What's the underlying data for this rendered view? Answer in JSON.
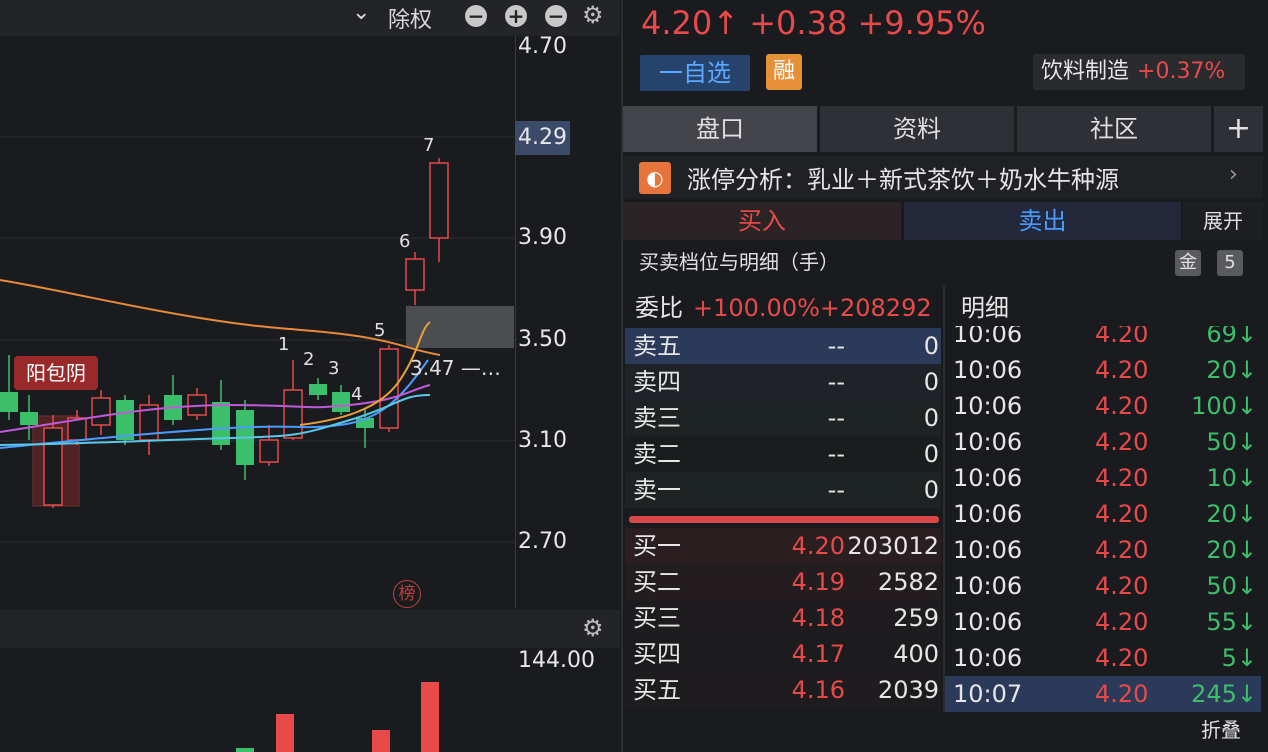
{
  "toolbar": {
    "dropdown_icon": "chevron-down",
    "chuquan_label": "除权"
  },
  "axis": {
    "ticks": [
      "4.70",
      "3.90",
      "3.50",
      "3.10",
      "2.70"
    ],
    "current": "4.29",
    "vol_tick": "144.00"
  },
  "chart": {
    "pattern_label": "阳包阴",
    "candle_numbers": [
      "1",
      "2",
      "3",
      "4",
      "5",
      "6",
      "7"
    ],
    "ma_label": "3.47 —…",
    "bang_label": "榜",
    "colors": {
      "up": "#e84a4a",
      "down": "#3bbf6a",
      "ma_orange": "#e88a3a",
      "ma_blue": "#4a9bff",
      "ma_purple": "#c05ad8",
      "ma_cyan": "#5ac8e8"
    }
  },
  "quote": {
    "price": "4.20↑",
    "change": "+0.38",
    "change_pct": "+9.95%",
    "watch_label": "一自选",
    "margin_label": "融",
    "industry": "饮料制造",
    "industry_chg": "+0.37%"
  },
  "tabs": [
    "盘口",
    "资料",
    "社区",
    "+"
  ],
  "limit_up": {
    "text": "涨停分析：乳业＋新式茶饮＋奶水牛种源",
    "arrow": "›"
  },
  "trade": {
    "buy": "买入",
    "sell": "卖出",
    "expand": "展开"
  },
  "book": {
    "title": "买卖档位与明细（手）",
    "badge_gold": "金",
    "badge_level": "5",
    "weibi_label": "委比",
    "weibi_value": "+100.00%+208292",
    "mingxi_label": "明细",
    "asks": [
      {
        "label": "卖五",
        "price": "--",
        "qty": "0"
      },
      {
        "label": "卖四",
        "price": "--",
        "qty": "0"
      },
      {
        "label": "卖三",
        "price": "--",
        "qty": "0"
      },
      {
        "label": "卖二",
        "price": "--",
        "qty": "0"
      },
      {
        "label": "卖一",
        "price": "--",
        "qty": "0"
      }
    ],
    "bids": [
      {
        "label": "买一",
        "price": "4.20",
        "qty": "203012"
      },
      {
        "label": "买二",
        "price": "4.19",
        "qty": "2582"
      },
      {
        "label": "买三",
        "price": "4.18",
        "qty": "259"
      },
      {
        "label": "买四",
        "price": "4.17",
        "qty": "400"
      },
      {
        "label": "买五",
        "price": "4.16",
        "qty": "2039"
      }
    ]
  },
  "trades": [
    {
      "time": "10:06",
      "price": "4.20",
      "qty": "69↓"
    },
    {
      "time": "10:06",
      "price": "4.20",
      "qty": "20↓"
    },
    {
      "time": "10:06",
      "price": "4.20",
      "qty": "100↓"
    },
    {
      "time": "10:06",
      "price": "4.20",
      "qty": "50↓"
    },
    {
      "time": "10:06",
      "price": "4.20",
      "qty": "10↓"
    },
    {
      "time": "10:06",
      "price": "4.20",
      "qty": "20↓"
    },
    {
      "time": "10:06",
      "price": "4.20",
      "qty": "20↓"
    },
    {
      "time": "10:06",
      "price": "4.20",
      "qty": "50↓"
    },
    {
      "time": "10:06",
      "price": "4.20",
      "qty": "55↓"
    },
    {
      "time": "10:06",
      "price": "4.20",
      "qty": "5↓"
    },
    {
      "time": "10:07",
      "price": "4.20",
      "qty": "245↓"
    }
  ],
  "collapse": "折叠"
}
